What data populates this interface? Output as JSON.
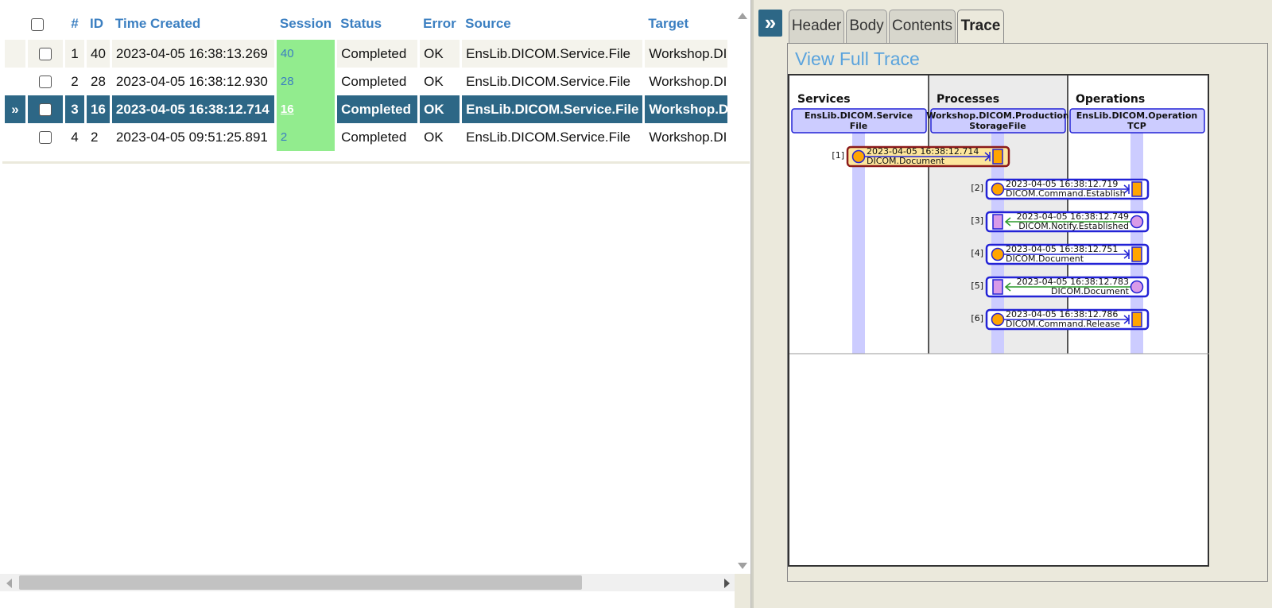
{
  "table": {
    "headers": [
      "#",
      "ID",
      "Time Created",
      "Session",
      "Status",
      "Error",
      "Source",
      "Target"
    ],
    "rows": [
      {
        "num": "1",
        "id": "40",
        "time": "2023-04-05 16:38:13.269",
        "session": "40",
        "status": "Completed",
        "error": "OK",
        "source": "EnsLib.DICOM.Service.File",
        "target": "Workshop.DIC"
      },
      {
        "num": "2",
        "id": "28",
        "time": "2023-04-05 16:38:12.930",
        "session": "28",
        "status": "Completed",
        "error": "OK",
        "source": "EnsLib.DICOM.Service.File",
        "target": "Workshop.DIC"
      },
      {
        "num": "3",
        "id": "16",
        "time": "2023-04-05 16:38:12.714",
        "session": "16",
        "status": "Completed",
        "error": "OK",
        "source": "EnsLib.DICOM.Service.File",
        "target": "Workshop.DI",
        "marker": "»"
      },
      {
        "num": "4",
        "id": "2",
        "time": "2023-04-05 09:51:25.891",
        "session": "2",
        "status": "Completed",
        "error": "OK",
        "source": "EnsLib.DICOM.Service.File",
        "target": "Workshop.DIC"
      }
    ]
  },
  "collapse_button": "»",
  "tabs": [
    "Header",
    "Body",
    "Contents",
    "Trace"
  ],
  "active_tab": "Trace",
  "view_full_trace": "View Full Trace",
  "trace": {
    "columns": [
      {
        "category": "Services",
        "host_line1": "EnsLib.DICOM.Service",
        "host_line2": "File"
      },
      {
        "category": "Processes",
        "host_line1": "Workshop.DICOM.Production",
        "host_line2": "StorageFile"
      },
      {
        "category": "Operations",
        "host_line1": "EnsLib.DICOM.Operation",
        "host_line2": "TCP"
      }
    ],
    "messages": [
      {
        "label": "[1]",
        "time": "2023-04-05 16:38:12.714",
        "name": "DICOM.Document",
        "direction": "request",
        "from": 0,
        "to": 1,
        "selected": true
      },
      {
        "label": "[2]",
        "time": "2023-04-05 16:38:12.719",
        "name": "DICOM.Command.Establish",
        "direction": "request",
        "from": 1,
        "to": 2,
        "selected": false
      },
      {
        "label": "[3]",
        "time": "2023-04-05 16:38:12.749",
        "name": "DICOM.Notify.Established",
        "direction": "response",
        "from": 2,
        "to": 1,
        "selected": false
      },
      {
        "label": "[4]",
        "time": "2023-04-05 16:38:12.751",
        "name": "DICOM.Document",
        "direction": "request",
        "from": 1,
        "to": 2,
        "selected": false
      },
      {
        "label": "[5]",
        "time": "2023-04-05 16:38:12.783",
        "name": "DICOM.Document",
        "direction": "response",
        "from": 2,
        "to": 1,
        "selected": false
      },
      {
        "label": "[6]",
        "time": "2023-04-05 16:38:12.786",
        "name": "DICOM.Command.Release",
        "direction": "request",
        "from": 1,
        "to": 2,
        "selected": false
      }
    ]
  },
  "colors": {
    "header_text": "#3b7fc1",
    "selected_row": "#2d6786",
    "session_cell": "#92ec8e",
    "request_arrow": "#2323d6",
    "response_arrow": "#2a9a2a",
    "request_circle": "#ffa500",
    "response_box": "#d99be8"
  }
}
